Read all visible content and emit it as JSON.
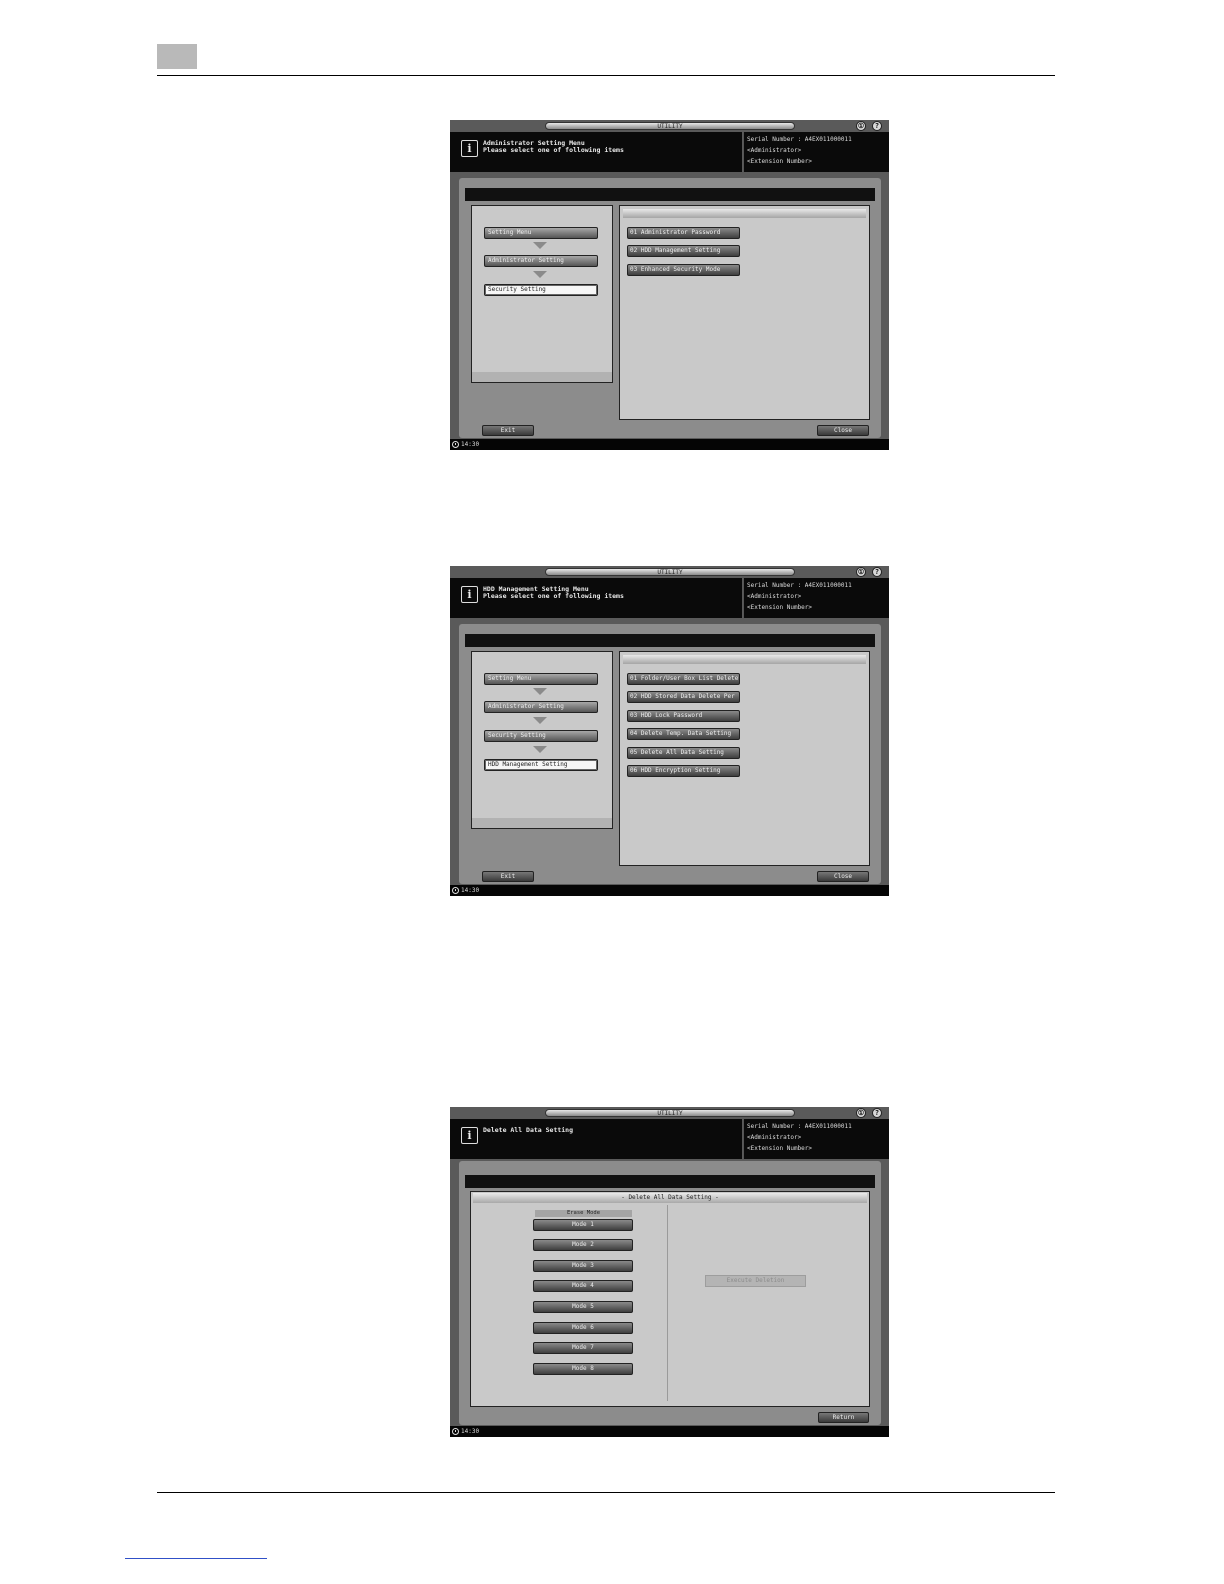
{
  "common": {
    "utility_title": "UTILITY",
    "icon_counter": "①",
    "icon_help": "?",
    "serial_line": "Serial Number   : A4EX011000011",
    "user_line": "<Administrator>",
    "ext_line": "<Extension Number>",
    "time": "14:30",
    "exit_label": "Exit",
    "close_label": "Close",
    "return_label": "Return"
  },
  "screen1": {
    "message_line1": "Administrator Setting Menu",
    "message_line2": "Please select one of following items",
    "breadcrumbs": [
      "Setting Menu",
      "Administrator Setting",
      "Security Setting"
    ],
    "menu_items": [
      "01 Administrator Password",
      "02 HDD Management Setting",
      "03 Enhanced Security Mode"
    ]
  },
  "screen2": {
    "message_line1": "HDD Management Setting Menu",
    "message_line2": "Please select one of following items",
    "breadcrumbs": [
      "Setting Menu",
      "Administrator Setting",
      "Security Setting",
      "HDD Management Setting"
    ],
    "menu_items": [
      "01 Folder/User Box List Delete",
      "02 HDD Stored Data Delete Per",
      "03 HDD Lock Password",
      "04 Delete Temp. Data Setting",
      "05 Delete All Data Setting",
      "06 HDD Encryption Setting"
    ]
  },
  "screen3": {
    "message_line1": "Delete All Data Setting",
    "panel_title": "- Delete All Data Setting -",
    "erase_mode_label": "Erase Mode",
    "modes": [
      "Mode 1",
      "Mode 2",
      "Mode 3",
      "Mode 4",
      "Mode 5",
      "Mode 6",
      "Mode 7",
      "Mode 8"
    ],
    "execute_label": "Execute Deletion"
  }
}
